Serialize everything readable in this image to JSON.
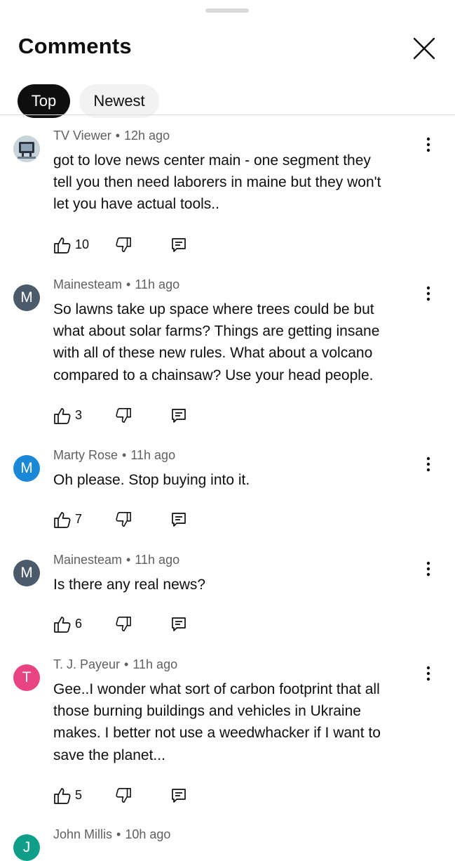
{
  "header": {
    "title": "Comments"
  },
  "tabs": [
    {
      "label": "Top",
      "selected": true
    },
    {
      "label": "Newest",
      "selected": false
    }
  ],
  "comments": [
    {
      "author": "TV Viewer",
      "time": "12h ago",
      "avatar_letter": "",
      "avatar_color": "#c9d3da",
      "lines": [
        "got to love news center main - one segment they",
        "tell you then need laborers in maine but they won't",
        "let you have actual tools.."
      ],
      "likes": "10"
    },
    {
      "author": "Mainesteam",
      "time": "11h ago",
      "avatar_letter": "M",
      "avatar_color": "#4b5b6b",
      "lines": [
        "So lawns take up space where trees could be but",
        "what about solar farms?  Things are getting insane",
        "with all of these new rules.  What about a volcano",
        "compared to a chainsaw?  Use your head people."
      ],
      "likes": "3"
    },
    {
      "author": "Marty Rose",
      "time": "11h ago",
      "avatar_letter": "M",
      "avatar_color": "#1a88d6",
      "lines": [
        "Oh please. Stop buying into it."
      ],
      "likes": "7"
    },
    {
      "author": "Mainesteam",
      "time": "11h ago",
      "avatar_letter": "M",
      "avatar_color": "#4b5b6b",
      "lines": [
        "Is there any real news?"
      ],
      "likes": "6"
    },
    {
      "author": "T. J. Payeur",
      "time": "11h ago",
      "avatar_letter": "T",
      "avatar_color": "#e94482",
      "lines": [
        "Gee..I wonder what sort of carbon footprint that all",
        "those burning buildings and vehicles in Ukraine",
        "makes. I better not use a weedwhacker if I want to",
        "save the planet..."
      ],
      "likes": "5"
    },
    {
      "author": "John Millis",
      "time": "10h ago",
      "avatar_letter": "J",
      "avatar_color": "#0e9e8a",
      "lines": [],
      "likes": ""
    }
  ]
}
